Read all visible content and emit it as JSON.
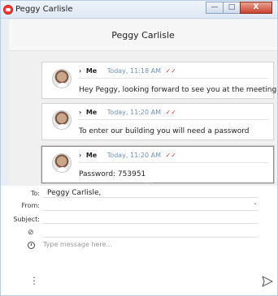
{
  "window": {
    "title": "Peggy Carlisle",
    "buttons": [
      "—",
      "□",
      "X"
    ]
  },
  "chat": {
    "contact_name": "Peggy Carlisle"
  },
  "messages": [
    {
      "sender": "Me",
      "time": "Today, 11:18 AM",
      "text": "Hey Peggy, looking forward to see you at the meeting today!"
    },
    {
      "sender": "Me",
      "time": "Today, 11:20 AM",
      "text": "To enter our building you will need a password"
    },
    {
      "sender": "Me",
      "time": "Today, 11:20 AM",
      "text": "Password: 753951"
    }
  ],
  "compose": {
    "to_label": "To:",
    "to_value": "Peggy Carlisle,",
    "from_label": "From:",
    "subject_label": "Subject:",
    "placeholder": "Type message here..."
  },
  "icons": {
    "attach": "paperclip-icon",
    "timer": "clock-icon",
    "more": "more-vertical-icon",
    "send": "send-icon"
  },
  "colors": {
    "timestamp": "#6f8fb8",
    "read_receipt": "#e53b2f",
    "close_button": "#c8442e"
  }
}
